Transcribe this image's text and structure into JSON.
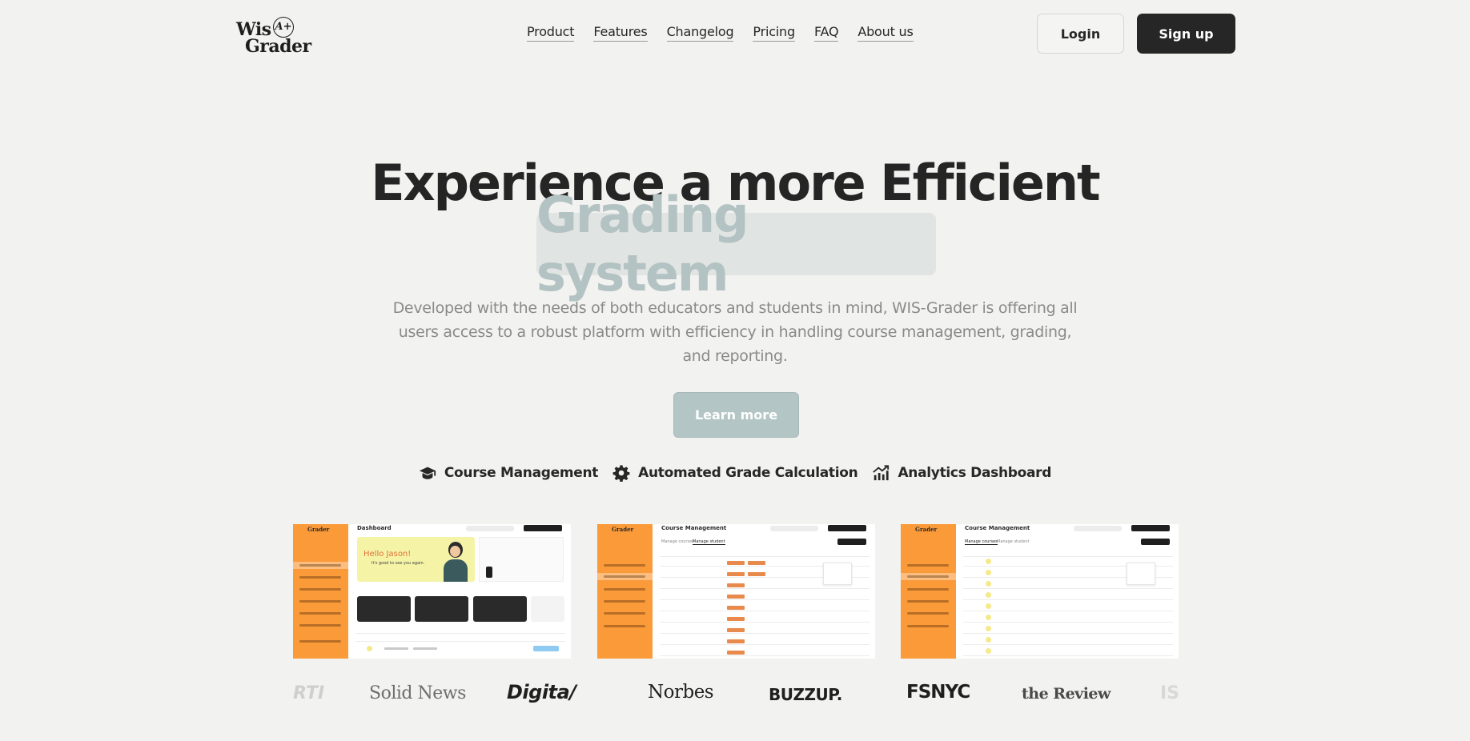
{
  "header": {
    "logo": {
      "line1": "Wis",
      "line2": "Grader",
      "badge": "A+"
    },
    "nav": [
      "Product",
      "Features",
      "Changelog",
      "Pricing",
      "FAQ",
      "About us"
    ],
    "login_label": "Login",
    "signup_label": "Sign up"
  },
  "hero": {
    "title": "Experience a more Efficient",
    "highlight": "Grading system",
    "description": "Developed with the needs of both educators and students in mind, WIS-Grader is offering all users access to a robust platform with efficiency in handling course management, grading, and reporting.",
    "cta_label": "Learn more"
  },
  "features": [
    {
      "icon": "graduation-cap-icon",
      "label": "Course Management"
    },
    {
      "icon": "gear-icon",
      "label": "Automated Grade Calculation"
    },
    {
      "icon": "analytics-chart-icon",
      "label": "Analytics Dashboard"
    }
  ],
  "cards": [
    {
      "title": "Dashboard",
      "greeting": "Hello Jason!",
      "subtitle": "It's good to see you again."
    },
    {
      "title": "Course Management",
      "tabs": [
        "Manage courses",
        "Manage student"
      ]
    },
    {
      "title": "Course Management",
      "tabs": [
        "Manage courses",
        "Manage student"
      ]
    }
  ],
  "logos": [
    "RTI",
    "Solid News",
    "Digita/",
    "Norbes",
    "BUZZUP.",
    "FSNYC",
    "the Review",
    "IS"
  ],
  "colors": {
    "accent_orange": "#fb9a39",
    "cta": "#b3c5c5",
    "dark_button": "#262626",
    "background": "#f2f2f0"
  }
}
